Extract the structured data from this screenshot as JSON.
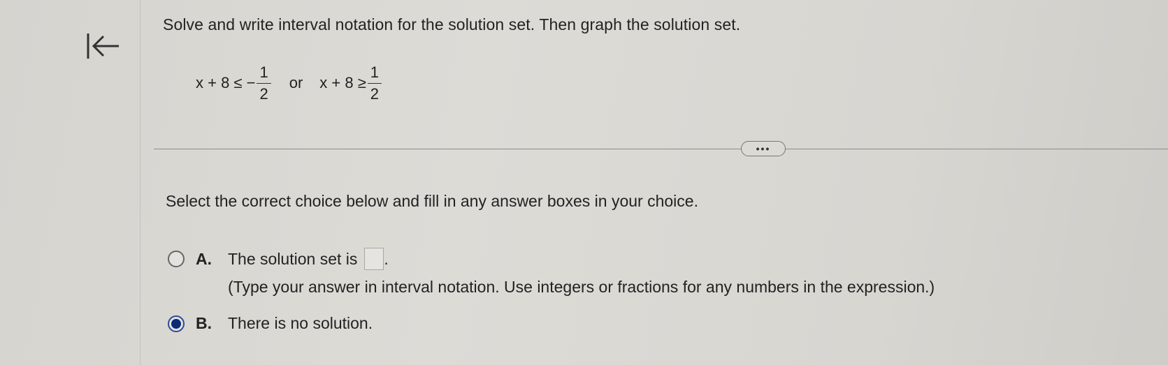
{
  "nav": {
    "back_icon": "arrow-to-start-icon"
  },
  "question": {
    "prompt": "Solve and write interval notation for the solution set. Then graph the solution set.",
    "inequality1_left": "x + 8 ≤ −",
    "inequality1_num": "1",
    "inequality1_den": "2",
    "connector": "or",
    "inequality2_left": "x + 8 ≥",
    "inequality2_num": "1",
    "inequality2_den": "2"
  },
  "more_button": {
    "label": "•••"
  },
  "instructions": {
    "text": "Select the correct choice below and fill in any answer boxes in your choice."
  },
  "choices": [
    {
      "letter": "A.",
      "text": "The solution set is",
      "suffix": ".",
      "hint": "(Type your answer in interval notation. Use integers or fractions for any numbers in the expression.)",
      "selected": false,
      "answer_value": ""
    },
    {
      "letter": "B.",
      "text": "There is no solution.",
      "selected": true
    }
  ],
  "colors": {
    "radio_selected": "#0b2a78",
    "background": "#dcdad5"
  }
}
